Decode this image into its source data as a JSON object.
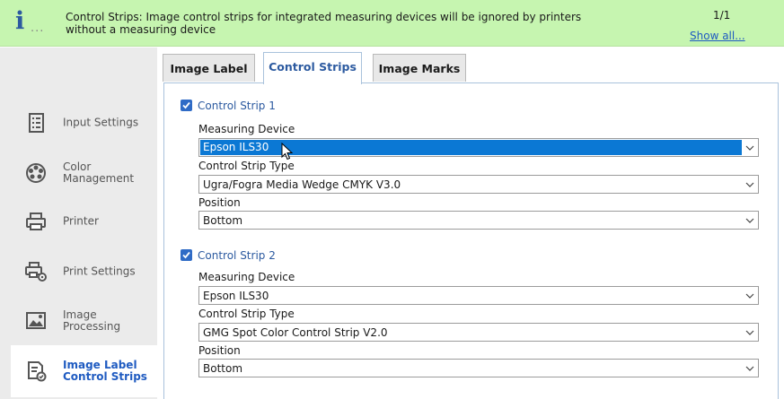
{
  "banner": {
    "message": "Control Strips: Image control strips for integrated measuring devices will be ignored by printers without a measuring device",
    "count": "1/1",
    "show_all": "Show all...",
    "info_dots": "..."
  },
  "sidebar": {
    "items": [
      {
        "label": "Input Settings",
        "icon": "input-settings-icon"
      },
      {
        "label": "Color Management",
        "icon": "color-management-icon"
      },
      {
        "label": "Printer",
        "icon": "printer-icon"
      },
      {
        "label": "Print Settings",
        "icon": "print-settings-icon"
      },
      {
        "label": "Image Processing",
        "icon": "image-processing-icon"
      },
      {
        "label": "Image Label Control Strips",
        "icon": "image-label-icon",
        "active": true
      }
    ]
  },
  "tabs": [
    {
      "label": "Image Label"
    },
    {
      "label": "Control Strips",
      "active": true
    },
    {
      "label": "Image Marks"
    }
  ],
  "strip1": {
    "label": "Control Strip 1",
    "checked": true,
    "measuring_device_label": "Measuring Device",
    "measuring_device": "Epson ILS30",
    "type_label": "Control Strip Type",
    "type": "Ugra/Fogra Media Wedge CMYK V3.0",
    "position_label": "Position",
    "position": "Bottom"
  },
  "strip2": {
    "label": "Control Strip 2",
    "checked": true,
    "measuring_device_label": "Measuring Device",
    "measuring_device": "Epson ILS30",
    "type_label": "Control Strip Type",
    "type": "GMG Spot Color Control Strip V2.0",
    "position_label": "Position",
    "position": "Bottom"
  },
  "colors": {
    "banner_bg": "#c6f5b0",
    "accent": "#2c5aa0",
    "link": "#1f5bc1",
    "selection": "#0b78d4",
    "checkbox": "#2f6bc6"
  }
}
